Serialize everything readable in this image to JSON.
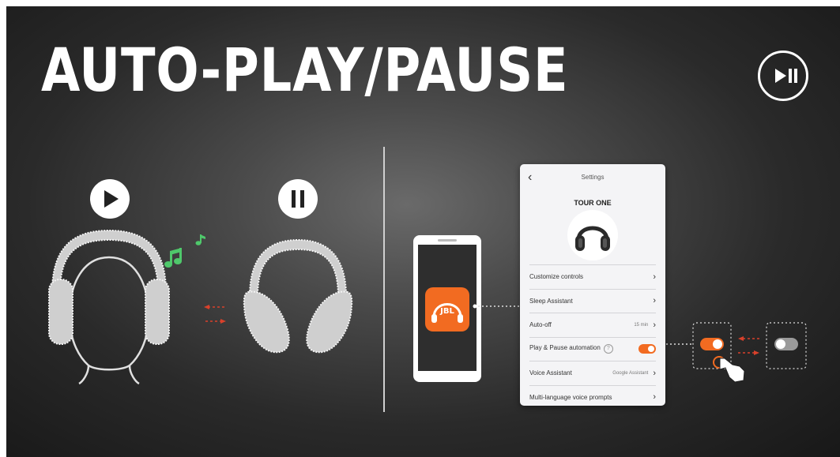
{
  "title": "AUTO-PLAY/PAUSE",
  "icons": {
    "badge": "play-pause-icon",
    "play": "play-icon",
    "pause": "pause-icon",
    "notes": "music-note-icon",
    "app": "jbl-app-icon",
    "hand": "hand-pointer-icon"
  },
  "app_icon_text": "JBL",
  "settings": {
    "header": "Settings",
    "device_name": "TOUR ONE",
    "items": [
      {
        "label": "Customize controls",
        "value": ""
      },
      {
        "label": "Sleep Assistant",
        "value": ""
      },
      {
        "label": "Auto-off",
        "value": "15 min"
      },
      {
        "label": "Play & Pause automation",
        "value": ""
      },
      {
        "label": "Voice Assistant",
        "value": "Google Assistant"
      },
      {
        "label": "Multi-language voice prompts",
        "value": ""
      }
    ]
  },
  "colors": {
    "accent": "#f26b21",
    "notes": "#4fc86b",
    "headphone": "#cfcfcf"
  }
}
